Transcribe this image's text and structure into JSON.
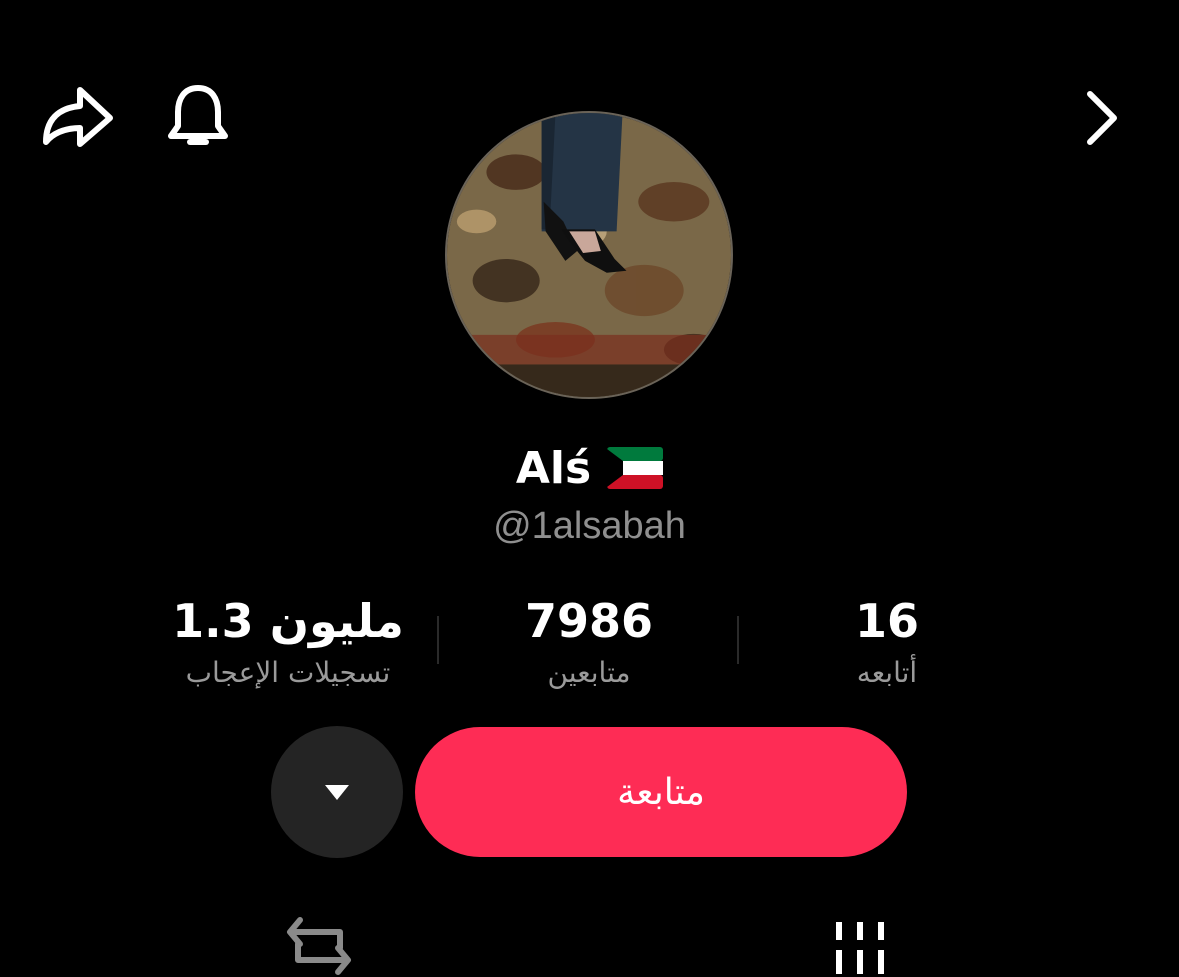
{
  "header": {
    "share_icon": "share-icon",
    "bell_icon": "bell-icon",
    "next_icon": "chevron-right-icon"
  },
  "profile": {
    "display_name": "Alś",
    "flag_icon": "kuwait-flag-icon",
    "username": "@1alsabah"
  },
  "stats": [
    {
      "value": "1.3 مليون",
      "label": "تسجيلات الإعجاب"
    },
    {
      "value": "7986",
      "label": "متابعين"
    },
    {
      "value": "16",
      "label": "أتابعه"
    }
  ],
  "actions": {
    "follow_label": "متابعة",
    "more_icon": "caret-down-icon"
  },
  "tabs": {
    "repost_icon": "repost-icon",
    "grid_icon": "grid-icon"
  },
  "colors": {
    "background": "#000000",
    "follow_button": "#fe2c55",
    "secondary_text": "#8f8f8f",
    "more_button": "#242424"
  }
}
